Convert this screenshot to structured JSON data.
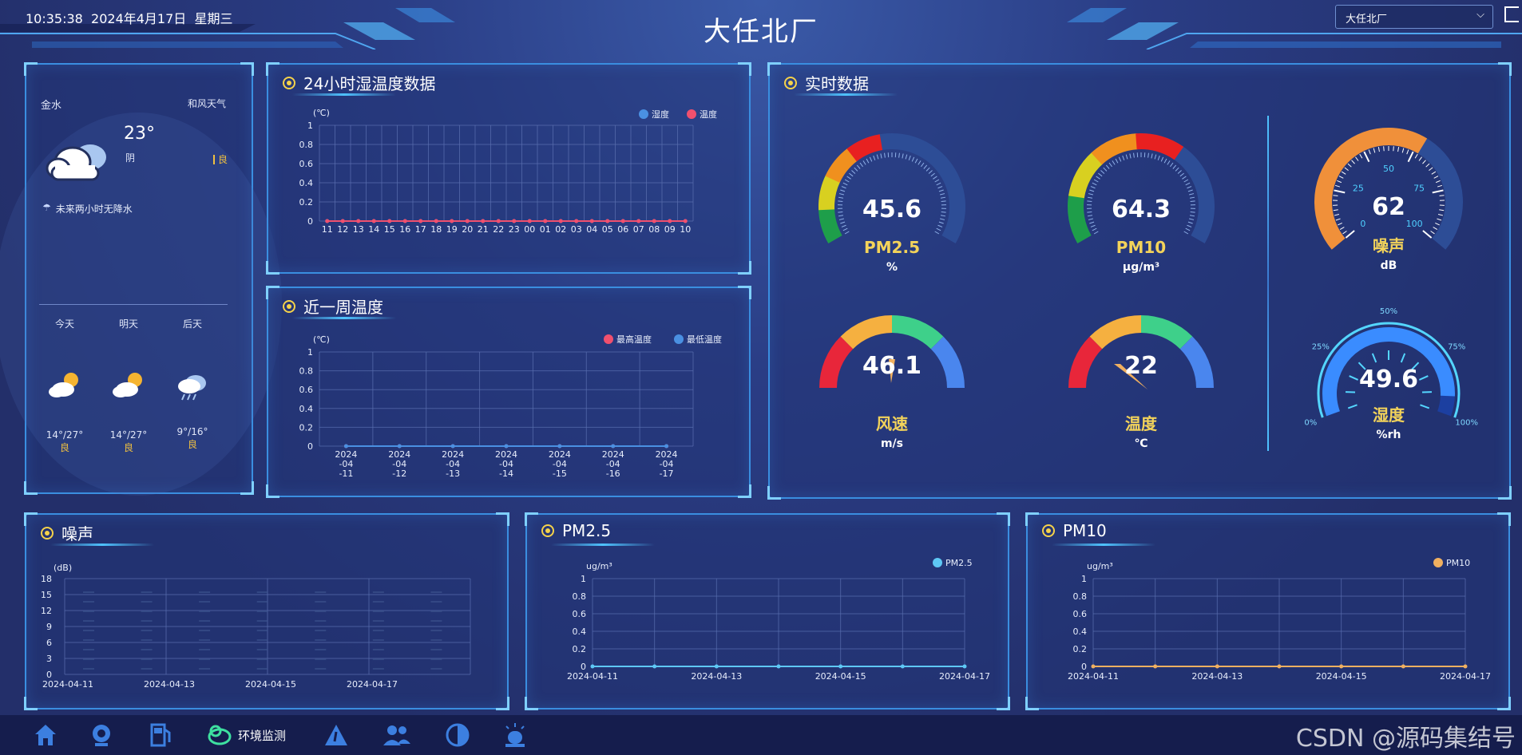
{
  "header": {
    "datetime": "10:35:38  2024年4月17日  星期三",
    "title": "大任北厂",
    "select_value": "大任北厂",
    "chevron_icon": "chevron-down-icon",
    "exit_icon": "logout-icon"
  },
  "weather": {
    "location": "金水",
    "tagline": "和风天气",
    "temp": "23°",
    "condition": "阴",
    "aqi": "良",
    "forecast_note": "未来两小时无降水",
    "days": [
      {
        "label": "今天",
        "range": "14°/27°",
        "aqi": "良",
        "icon": "partly-cloudy-icon"
      },
      {
        "label": "明天",
        "range": "14°/27°",
        "aqi": "良",
        "icon": "partly-cloudy-icon"
      },
      {
        "label": "后天",
        "range": "9°/16°",
        "aqi": "良",
        "icon": "rain-cloud-icon"
      }
    ]
  },
  "panels": {
    "humidity24": {
      "title": "24小时湿温度数据"
    },
    "weekTemp": {
      "title": "近一周温度"
    },
    "realtime": {
      "title": "实时数据"
    },
    "noise": {
      "title": "噪声"
    },
    "pm25": {
      "title": "PM2.5"
    },
    "pm10": {
      "title": "PM10"
    }
  },
  "gauges": [
    {
      "key": "pm25",
      "value": "45.6",
      "label": "PM2.5",
      "unit": "%"
    },
    {
      "key": "pm10",
      "value": "64.3",
      "label": "PM10",
      "unit": "μg/m³"
    },
    {
      "key": "noise",
      "value": "62",
      "label": "噪声",
      "unit": "dB",
      "ticks": [
        "0",
        "25",
        "50",
        "75",
        "100"
      ],
      "level": 0.62
    },
    {
      "key": "wind",
      "value": "46.1",
      "label": "风速",
      "unit": "m/s"
    },
    {
      "key": "temp",
      "value": "22",
      "label": "温度",
      "unit": "℃"
    },
    {
      "key": "humidity",
      "value": "49.6",
      "label": "湿度",
      "unit": "%rh",
      "ticks": [
        "0%",
        "25%",
        "50%",
        "75%",
        "100%"
      ],
      "level": 0.496
    }
  ],
  "chart_data": [
    {
      "type": "line",
      "id": "humidity24",
      "ylabel": "(℃)",
      "categories": [
        "11",
        "12",
        "13",
        "14",
        "15",
        "16",
        "17",
        "18",
        "19",
        "20",
        "21",
        "22",
        "23",
        "00",
        "01",
        "02",
        "03",
        "04",
        "05",
        "06",
        "07",
        "08",
        "09",
        "10"
      ],
      "series": [
        {
          "name": "湿度",
          "color": "#4a90e2",
          "values": [
            0,
            0,
            0,
            0,
            0,
            0,
            0,
            0,
            0,
            0,
            0,
            0,
            0,
            0,
            0,
            0,
            0,
            0,
            0,
            0,
            0,
            0,
            0,
            0
          ]
        },
        {
          "name": "温度",
          "color": "#f0506e",
          "values": [
            0,
            0,
            0,
            0,
            0,
            0,
            0,
            0,
            0,
            0,
            0,
            0,
            0,
            0,
            0,
            0,
            0,
            0,
            0,
            0,
            0,
            0,
            0,
            0
          ]
        }
      ],
      "yticks": [
        "0",
        "0.2",
        "0.4",
        "0.6",
        "0.8",
        "1"
      ],
      "ylim": [
        0,
        1
      ]
    },
    {
      "type": "line",
      "id": "weekTemp",
      "ylabel": "(℃)",
      "categories": [
        "2024-04-11",
        "2024-04-12",
        "2024-04-13",
        "2024-04-14",
        "2024-04-15",
        "2024-04-16",
        "2024-04-17"
      ],
      "series": [
        {
          "name": "最高温度",
          "color": "#f0506e",
          "values": [
            0,
            0,
            0,
            0,
            0,
            0,
            0
          ]
        },
        {
          "name": "最低温度",
          "color": "#4a90e2",
          "values": [
            0,
            0,
            0,
            0,
            0,
            0,
            0
          ]
        }
      ],
      "yticks": [
        "0",
        "0.2",
        "0.4",
        "0.6",
        "0.8",
        "1"
      ],
      "ylim": [
        0,
        1
      ]
    },
    {
      "type": "bar",
      "id": "noise",
      "ylabel": "(dB)",
      "categories": [
        "2024-04-11",
        "2024-04-13",
        "2024-04-15",
        "2024-04-17"
      ],
      "yticks": [
        "0",
        "3",
        "6",
        "9",
        "12",
        "15",
        "18"
      ],
      "ylim": [
        0,
        18
      ],
      "series": [
        {
          "values": [
            0,
            0,
            0,
            0,
            0,
            0,
            0
          ]
        }
      ]
    },
    {
      "type": "line",
      "id": "pm25",
      "ylabel": "ug/m³",
      "categories": [
        "2024-04-11",
        "2024-04-13",
        "2024-04-15",
        "2024-04-17"
      ],
      "series": [
        {
          "name": "PM2.5",
          "color": "#5ec8f5",
          "values": [
            0,
            0,
            0,
            0,
            0,
            0,
            0
          ]
        }
      ],
      "yticks": [
        "0",
        "0.2",
        "0.4",
        "0.6",
        "0.8",
        "1"
      ],
      "ylim": [
        0,
        1
      ]
    },
    {
      "type": "line",
      "id": "pm10",
      "ylabel": "ug/m³",
      "categories": [
        "2024-04-11",
        "2024-04-13",
        "2024-04-15",
        "2024-04-17"
      ],
      "series": [
        {
          "name": "PM10",
          "color": "#f0b060",
          "values": [
            0,
            0,
            0,
            0,
            0,
            0,
            0
          ]
        }
      ],
      "yticks": [
        "0",
        "0.2",
        "0.4",
        "0.6",
        "0.8",
        "1"
      ],
      "ylim": [
        0,
        1
      ]
    }
  ],
  "nav": {
    "items": [
      {
        "icon": "home-icon"
      },
      {
        "icon": "camera-icon"
      },
      {
        "icon": "gas-station-icon"
      },
      {
        "icon": "environment-cloud-icon",
        "label": "环境监测"
      },
      {
        "icon": "warning-icon"
      },
      {
        "icon": "users-icon"
      },
      {
        "icon": "pie-chart-icon"
      },
      {
        "icon": "alarm-icon"
      }
    ]
  },
  "watermark": "CSDN @源码集结号"
}
